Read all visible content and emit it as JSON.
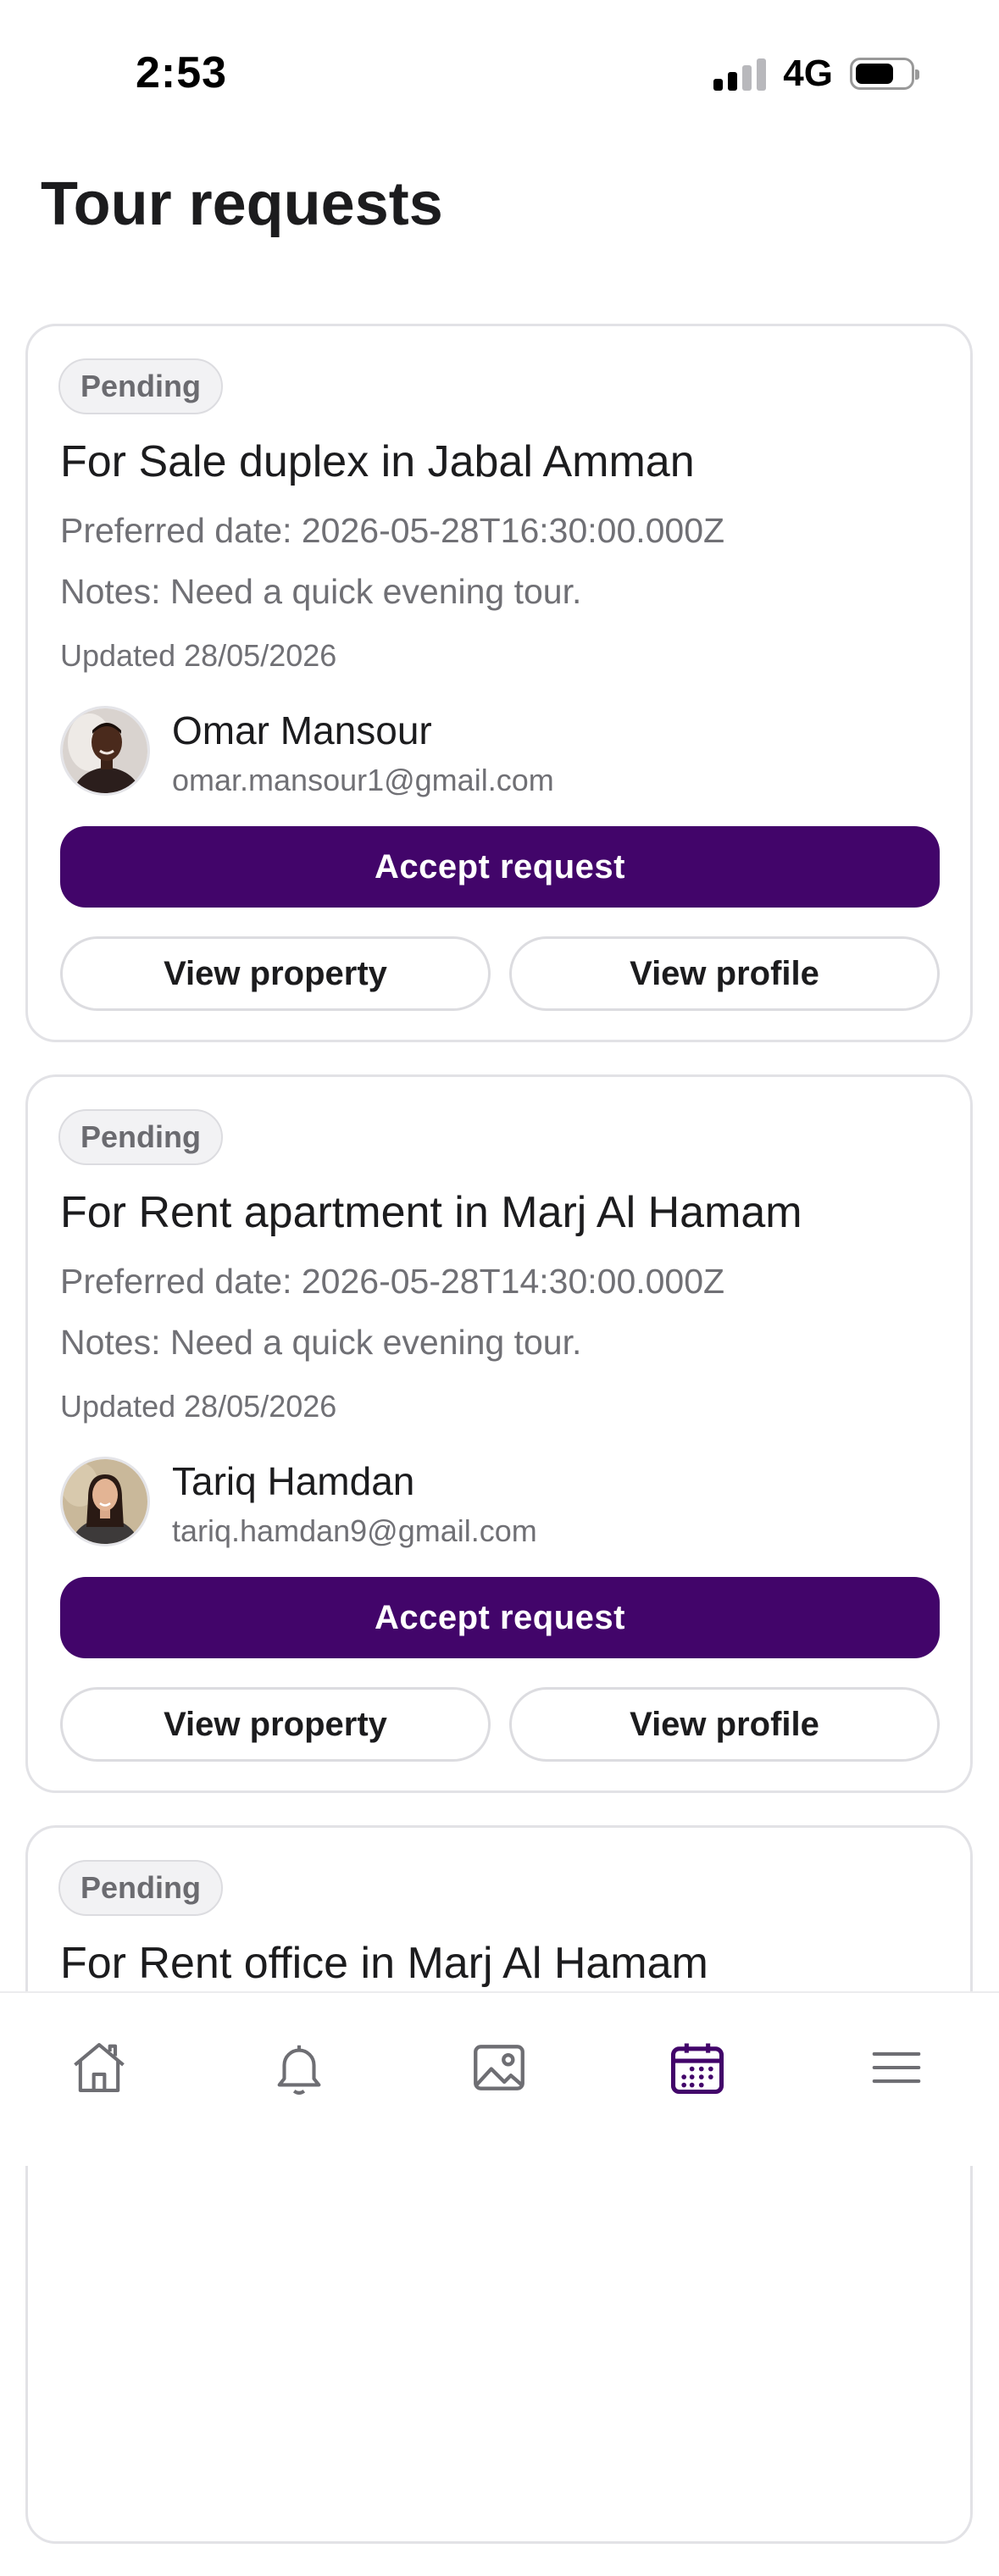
{
  "status_bar": {
    "time": "2:53",
    "network": "4G"
  },
  "page": {
    "title": "Tour requests"
  },
  "requests": [
    {
      "status": "Pending",
      "title": "For Sale duplex in Jabal Amman",
      "preferred_date": "Preferred date: 2026-05-28T16:30:00.000Z",
      "notes": "Notes: Need a quick evening tour.",
      "updated": "Updated 28/05/2026",
      "requester_name": "Omar Mansour",
      "requester_email": "omar.mansour1@gmail.com",
      "accept_label": "Accept request",
      "view_property_label": "View property",
      "view_profile_label": "View profile"
    },
    {
      "status": "Pending",
      "title": "For Rent apartment in Marj Al Hamam",
      "preferred_date": "Preferred date: 2026-05-28T14:30:00.000Z",
      "notes": "Notes: Need a quick evening tour.",
      "updated": "Updated 28/05/2026",
      "requester_name": "Tariq Hamdan",
      "requester_email": "tariq.hamdan9@gmail.com",
      "accept_label": "Accept request",
      "view_property_label": "View property",
      "view_profile_label": "View profile"
    },
    {
      "status": "Pending",
      "title": "For Rent office in Marj Al Hamam"
    }
  ],
  "tab_bar": {
    "items": [
      {
        "icon": "home-icon",
        "active": false
      },
      {
        "icon": "bell-icon",
        "active": false
      },
      {
        "icon": "image-icon",
        "active": false
      },
      {
        "icon": "calendar-icon",
        "active": true
      },
      {
        "icon": "menu-icon",
        "active": false
      }
    ]
  },
  "colors": {
    "primary": "#42056a",
    "muted_text": "#707075",
    "icon_default": "#6e6e73",
    "badge_bg": "#f2f2f4"
  }
}
